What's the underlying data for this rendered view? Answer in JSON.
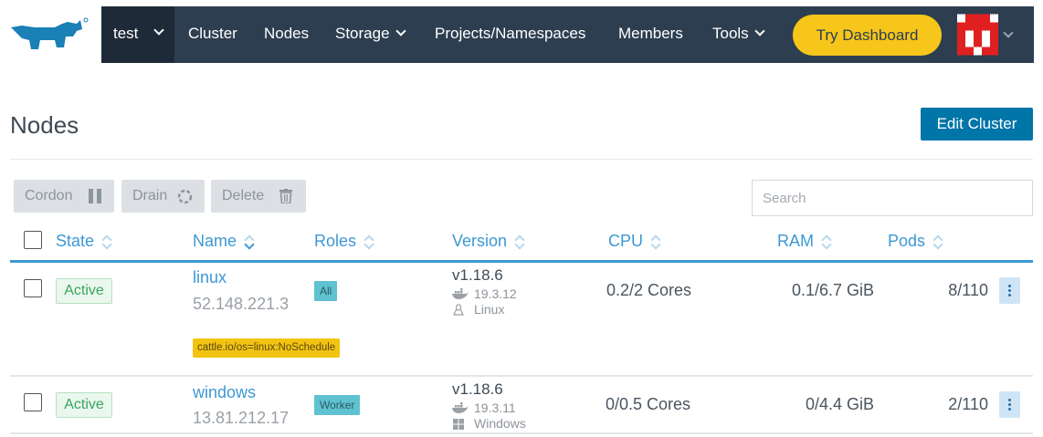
{
  "header": {
    "cluster": "test",
    "nav": [
      {
        "label": "Cluster",
        "dropdown": false
      },
      {
        "label": "Nodes",
        "dropdown": false
      },
      {
        "label": "Storage",
        "dropdown": true
      },
      {
        "label": "Projects/Namespaces",
        "dropdown": false
      },
      {
        "label": "Members",
        "dropdown": false
      },
      {
        "label": "Tools",
        "dropdown": true
      }
    ],
    "try_dashboard": "Try Dashboard",
    "colors": {
      "navbar": "#2d3e50",
      "accent": "#f7c61a",
      "logo": "#1a80b6"
    }
  },
  "page": {
    "title": "Nodes",
    "edit_cluster": "Edit Cluster"
  },
  "bulk": {
    "cordon": "Cordon",
    "drain": "Drain",
    "delete": "Delete"
  },
  "search": {
    "placeholder": "Search",
    "value": ""
  },
  "table": {
    "columns": [
      "State",
      "Name",
      "Roles",
      "Version",
      "CPU",
      "RAM",
      "Pods"
    ],
    "rows": [
      {
        "state": "Active",
        "name": "linux",
        "ip": "52.148.221.3",
        "role": "All",
        "taint": "cattle.io/os=linux:NoSchedule",
        "version": "v1.18.6",
        "docker": "19.3.12",
        "os": "Linux",
        "cpu": "0.2/2 Cores",
        "ram": "0.1/6.7 GiB",
        "pods": "8/110"
      },
      {
        "state": "Active",
        "name": "windows",
        "ip": "13.81.212.171",
        "role": "Worker",
        "taint": "",
        "version": "v1.18.6",
        "docker": "19.3.11",
        "os": "Windows",
        "cpu": "0/0.5 Cores",
        "ram": "0/4.4 GiB",
        "pods": "2/110"
      }
    ]
  }
}
